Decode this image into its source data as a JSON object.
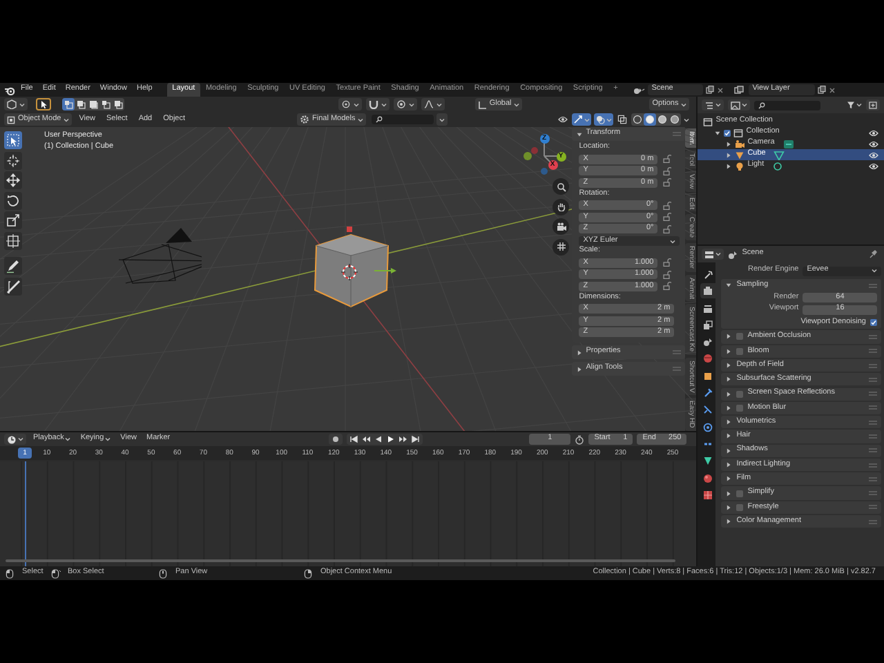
{
  "topbar": {
    "menus": [
      "File",
      "Edit",
      "Render",
      "Window",
      "Help"
    ],
    "workspaces": [
      {
        "label": "Layout",
        "selected": true
      },
      {
        "label": "Modeling",
        "selected": false
      },
      {
        "label": "Sculpting",
        "selected": false
      },
      {
        "label": "UV Editing",
        "selected": false
      },
      {
        "label": "Texture Paint",
        "selected": false
      },
      {
        "label": "Shading",
        "selected": false
      },
      {
        "label": "Animation",
        "selected": false
      },
      {
        "label": "Rendering",
        "selected": false
      },
      {
        "label": "Compositing",
        "selected": false
      },
      {
        "label": "Scripting",
        "selected": false
      }
    ],
    "add_workspace": "+",
    "scene": "Scene",
    "view_layer": "View Layer"
  },
  "viewport": {
    "tool_header": {
      "select_modes": [
        {
          "selected": true
        },
        {
          "selected": false
        },
        {
          "selected": false
        },
        {
          "selected": false
        },
        {
          "selected": false
        }
      ],
      "orientation": "Global",
      "options": "Options"
    },
    "header": {
      "mode": "Object Mode",
      "menus": [
        "View",
        "Select",
        "Add",
        "Object"
      ],
      "filter": "Final Models",
      "shading_modes": [
        {
          "selected": false
        },
        {
          "selected": true
        },
        {
          "selected": false
        },
        {
          "selected": false
        }
      ]
    },
    "tools": [
      {
        "kind": "select",
        "selected": true
      },
      {
        "kind": "cursor",
        "selected": false
      },
      {
        "kind": "move",
        "selected": false
      },
      {
        "kind": "rotate",
        "selected": false
      },
      {
        "kind": "scale",
        "selected": false
      },
      {
        "kind": "transform",
        "selected": false
      },
      {
        "kind": "annotate",
        "selected": false
      },
      {
        "kind": "measure",
        "selected": false
      }
    ],
    "info": [
      "User Perspective",
      "(1) Collection | Cube"
    ],
    "axes": [
      {
        "kind": "z",
        "label": "Z"
      },
      {
        "kind": "y",
        "label": "Y"
      },
      {
        "kind": "x",
        "label": "X"
      }
    ]
  },
  "sidebar": {
    "tabs": [
      {
        "label": "Item",
        "selected": true
      },
      {
        "label": "Tool",
        "selected": false
      },
      {
        "label": "View",
        "selected": false
      },
      {
        "label": "Edit",
        "selected": false
      },
      {
        "label": "Create",
        "selected": false
      },
      {
        "label": "Render",
        "selected": false
      },
      {
        "label": "Animat",
        "selected": false
      },
      {
        "label": "Screencast Ke",
        "selected": false
      },
      {
        "label": "Shortcut V",
        "selected": false
      },
      {
        "label": "Easy HD",
        "selected": false
      }
    ],
    "transform": {
      "title": "Transform",
      "expanded": true,
      "groups": [
        {
          "label": "Location:",
          "rows": [
            {
              "axis": "X",
              "value": "0 m",
              "locked": false
            },
            {
              "axis": "Y",
              "value": "0 m",
              "locked": false
            },
            {
              "axis": "Z",
              "value": "0 m",
              "locked": false
            }
          ]
        },
        {
          "label": "Rotation:",
          "rows": [
            {
              "axis": "X",
              "value": "0°",
              "locked": false
            },
            {
              "axis": "Y",
              "value": "0°",
              "locked": false
            },
            {
              "axis": "Z",
              "value": "0°",
              "locked": false
            }
          ],
          "mode": "XYZ Euler"
        },
        {
          "label": "Scale:",
          "rows": [
            {
              "axis": "X",
              "value": "1.000",
              "locked": false
            },
            {
              "axis": "Y",
              "value": "1.000",
              "locked": false
            },
            {
              "axis": "Z",
              "value": "1.000",
              "locked": false
            }
          ]
        },
        {
          "label": "Dimensions:",
          "rows": [
            {
              "axis": "X",
              "value": "2 m"
            },
            {
              "axis": "Y",
              "value": "2 m"
            },
            {
              "axis": "Z",
              "value": "2 m"
            }
          ]
        }
      ]
    },
    "panels": [
      {
        "title": "Properties",
        "expanded": false
      },
      {
        "title": "Align Tools",
        "expanded": false
      }
    ]
  },
  "timeline": {
    "menus": [
      {
        "label": "Playback",
        "kind": "dropdown"
      },
      {
        "label": "Keying",
        "kind": "dropdown"
      },
      {
        "label": "View",
        "kind": "menu"
      },
      {
        "label": "Marker",
        "kind": "menu"
      }
    ],
    "auto_keying": false,
    "current_frame": "1",
    "start_label": "Start",
    "start": "1",
    "end_label": "End",
    "end": "250",
    "playhead": "1",
    "ruler": [
      "10",
      "20",
      "30",
      "40",
      "50",
      "60",
      "70",
      "80",
      "90",
      "100",
      "110",
      "120",
      "130",
      "140",
      "150",
      "160",
      "170",
      "180",
      "190",
      "200",
      "210",
      "220",
      "230",
      "240",
      "250"
    ]
  },
  "outliner": {
    "items": [
      {
        "label": "Scene Collection",
        "kind": "scene_collection",
        "selected": false,
        "children": [
          {
            "label": "Collection",
            "kind": "collection",
            "expanded": true,
            "checked": true,
            "visible": true,
            "selected": false,
            "children": [
              {
                "label": "Camera",
                "kind": "camera",
                "expanded": false,
                "visible": true,
                "selected": false
              },
              {
                "label": "Cube",
                "kind": "mesh",
                "expanded": false,
                "visible": true,
                "selected": true
              },
              {
                "label": "Light",
                "kind": "light",
                "expanded": false,
                "visible": true,
                "selected": false
              }
            ]
          }
        ]
      }
    ]
  },
  "properties": {
    "context": "Scene",
    "tabs": [
      {
        "kind": "tool",
        "selected": false
      },
      {
        "kind": "render",
        "selected": true
      },
      {
        "kind": "output",
        "selected": false
      },
      {
        "kind": "view_layer",
        "selected": false
      },
      {
        "kind": "scene",
        "selected": false
      },
      {
        "kind": "world",
        "selected": false
      },
      {
        "kind": "object",
        "selected": false
      },
      {
        "kind": "modifiers",
        "selected": false
      },
      {
        "kind": "particles",
        "selected": false
      },
      {
        "kind": "physics",
        "selected": false
      },
      {
        "kind": "constraints",
        "selected": false
      },
      {
        "kind": "data",
        "selected": false
      },
      {
        "kind": "material",
        "selected": false
      },
      {
        "kind": "texture",
        "selected": false
      }
    ],
    "render_engine": {
      "label": "Render Engine",
      "value": "Eevee"
    },
    "sampling": {
      "title": "Sampling",
      "expanded": true,
      "fields": [
        {
          "label": "Render",
          "value": "64"
        },
        {
          "label": "Viewport",
          "value": "16"
        }
      ],
      "denoising": {
        "label": "Viewport Denoising",
        "checked": true
      }
    },
    "panels": [
      {
        "label": "Ambient Occlusion",
        "kind": "toggle",
        "checked": false,
        "expanded": false
      },
      {
        "label": "Bloom",
        "kind": "toggle",
        "checked": false,
        "expanded": false
      },
      {
        "label": "Depth of Field",
        "kind": "plain",
        "expanded": false
      },
      {
        "label": "Subsurface Scattering",
        "kind": "plain",
        "expanded": false
      },
      {
        "label": "Screen Space Reflections",
        "kind": "toggle",
        "checked": false,
        "expanded": false
      },
      {
        "label": "Motion Blur",
        "kind": "toggle",
        "checked": false,
        "expanded": false
      },
      {
        "label": "Volumetrics",
        "kind": "plain",
        "expanded": false
      },
      {
        "label": "Hair",
        "kind": "plain",
        "expanded": false
      },
      {
        "label": "Shadows",
        "kind": "plain",
        "expanded": false
      },
      {
        "label": "Indirect Lighting",
        "kind": "plain",
        "expanded": false
      },
      {
        "label": "Film",
        "kind": "plain",
        "expanded": false
      },
      {
        "label": "Simplify",
        "kind": "toggle",
        "checked": false,
        "expanded": false
      },
      {
        "label": "Freestyle",
        "kind": "toggle",
        "checked": false,
        "expanded": false
      },
      {
        "label": "Color Management",
        "kind": "plain",
        "expanded": false
      }
    ]
  },
  "status_bar": {
    "hints": [
      {
        "kind": "left_click",
        "label": "Select"
      },
      {
        "kind": "drag",
        "label": "Box Select"
      },
      {
        "kind": "middle_click",
        "label": "Pan View"
      },
      {
        "kind": "right_click",
        "label": "Object Context Menu"
      }
    ],
    "stats": "Collection | Cube | Verts:8 | Faces:6 | Tris:12 | Objects:1/3 | Mem: 26.0 MiB | v2.82.7"
  }
}
